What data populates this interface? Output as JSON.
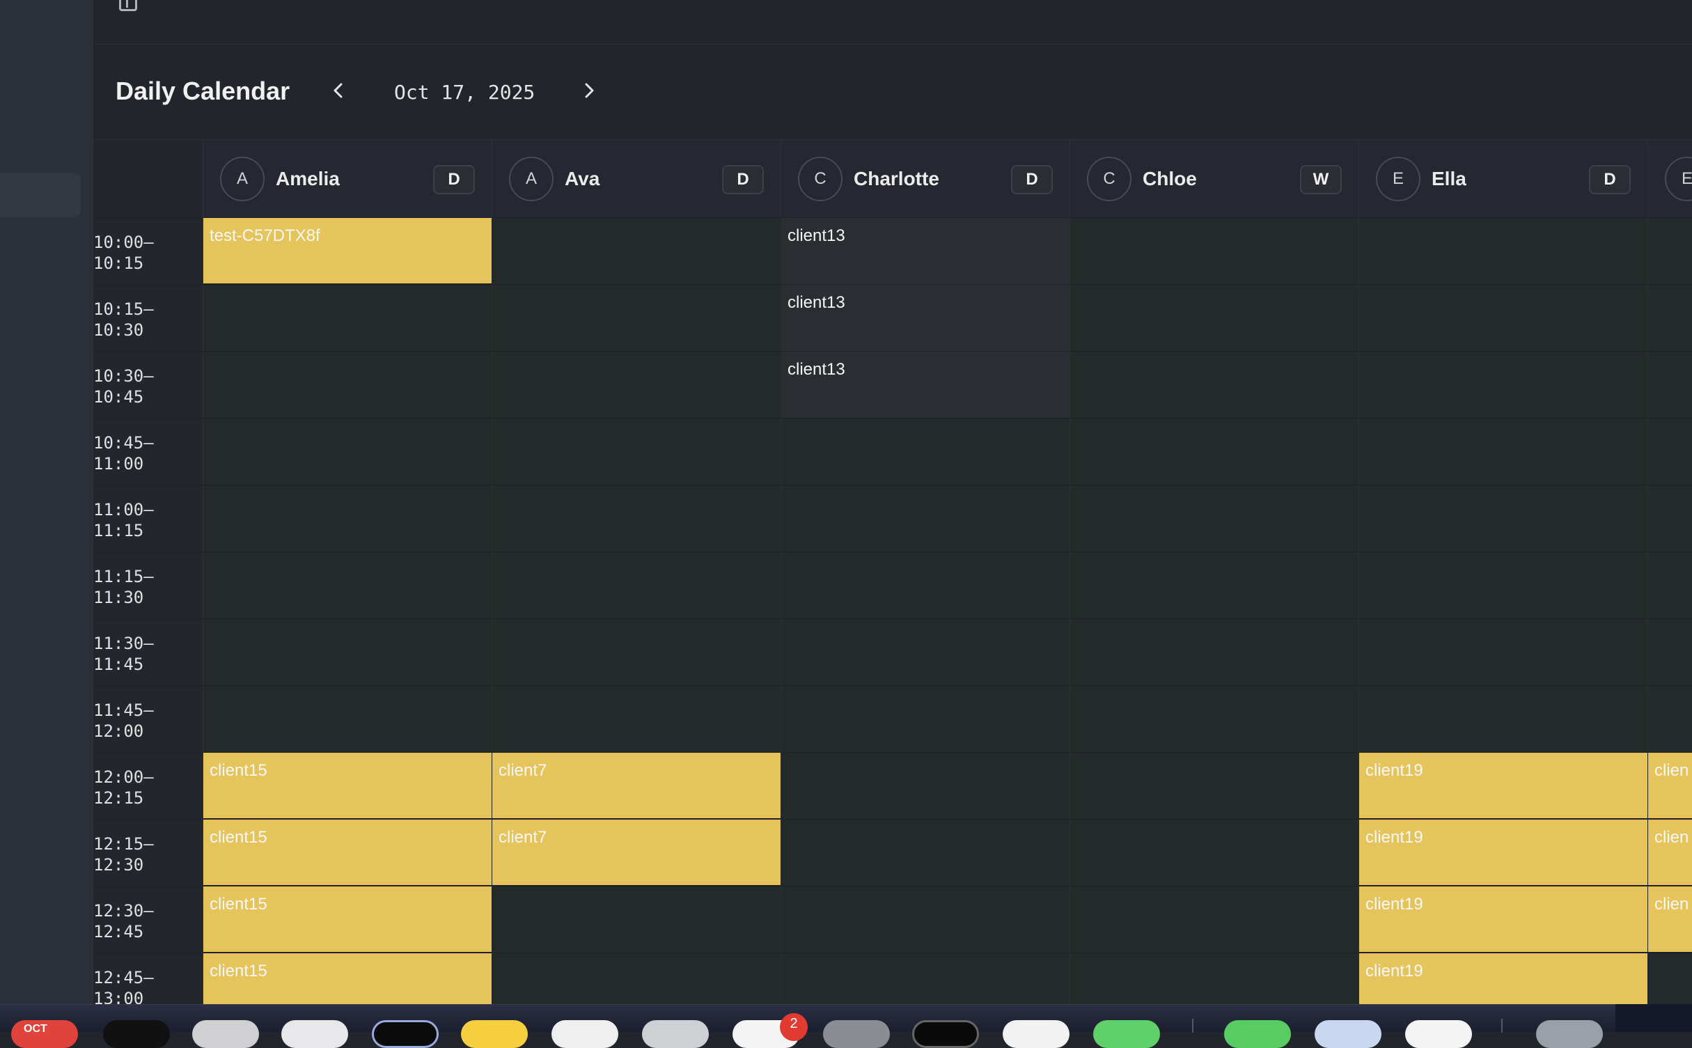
{
  "calendar": {
    "title": "Daily Calendar",
    "date": "Oct 17, 2025"
  },
  "staff": [
    {
      "initial": "A",
      "name": "Amelia",
      "badge": "D"
    },
    {
      "initial": "A",
      "name": "Ava",
      "badge": "D"
    },
    {
      "initial": "C",
      "name": "Charlotte",
      "badge": "D"
    },
    {
      "initial": "C",
      "name": "Chloe",
      "badge": "W"
    },
    {
      "initial": "E",
      "name": "Ella",
      "badge": "D"
    },
    {
      "initial": "E",
      "name": "",
      "badge": ""
    }
  ],
  "time_slots": [
    {
      "start": "10:00–",
      "end": "10:15",
      "cells": [
        "test-C57DTX8f",
        "",
        "client13",
        "",
        "",
        ""
      ]
    },
    {
      "start": "10:15–",
      "end": "10:30",
      "cells": [
        "",
        "",
        "client13",
        "",
        "",
        ""
      ]
    },
    {
      "start": "10:30–",
      "end": "10:45",
      "cells": [
        "",
        "",
        "client13",
        "",
        "",
        ""
      ]
    },
    {
      "start": "10:45–",
      "end": "11:00",
      "cells": [
        "",
        "",
        "",
        "",
        "",
        ""
      ]
    },
    {
      "start": "11:00–",
      "end": "11:15",
      "cells": [
        "",
        "",
        "",
        "",
        "",
        ""
      ]
    },
    {
      "start": "11:15–",
      "end": "11:30",
      "cells": [
        "",
        "",
        "",
        "",
        "",
        ""
      ]
    },
    {
      "start": "11:30–",
      "end": "11:45",
      "cells": [
        "",
        "",
        "",
        "",
        "",
        ""
      ]
    },
    {
      "start": "11:45–",
      "end": "12:00",
      "cells": [
        "",
        "",
        "",
        "",
        "",
        ""
      ]
    },
    {
      "start": "12:00–",
      "end": "12:15",
      "cells": [
        "client15",
        "client7",
        "",
        "",
        "client19",
        "clien"
      ]
    },
    {
      "start": "12:15–",
      "end": "12:30",
      "cells": [
        "client15",
        "client7",
        "",
        "",
        "client19",
        "clien"
      ]
    },
    {
      "start": "12:30–",
      "end": "12:45",
      "cells": [
        "client15",
        "",
        "",
        "",
        "client19",
        "clien"
      ]
    },
    {
      "start": "12:45–",
      "end": "13:00",
      "cells": [
        "client15",
        "",
        "",
        "",
        "client19",
        ""
      ]
    }
  ],
  "booked_color": "#e6c45c",
  "dock": {
    "calendar_month": "OCT",
    "badge_count": "2"
  }
}
